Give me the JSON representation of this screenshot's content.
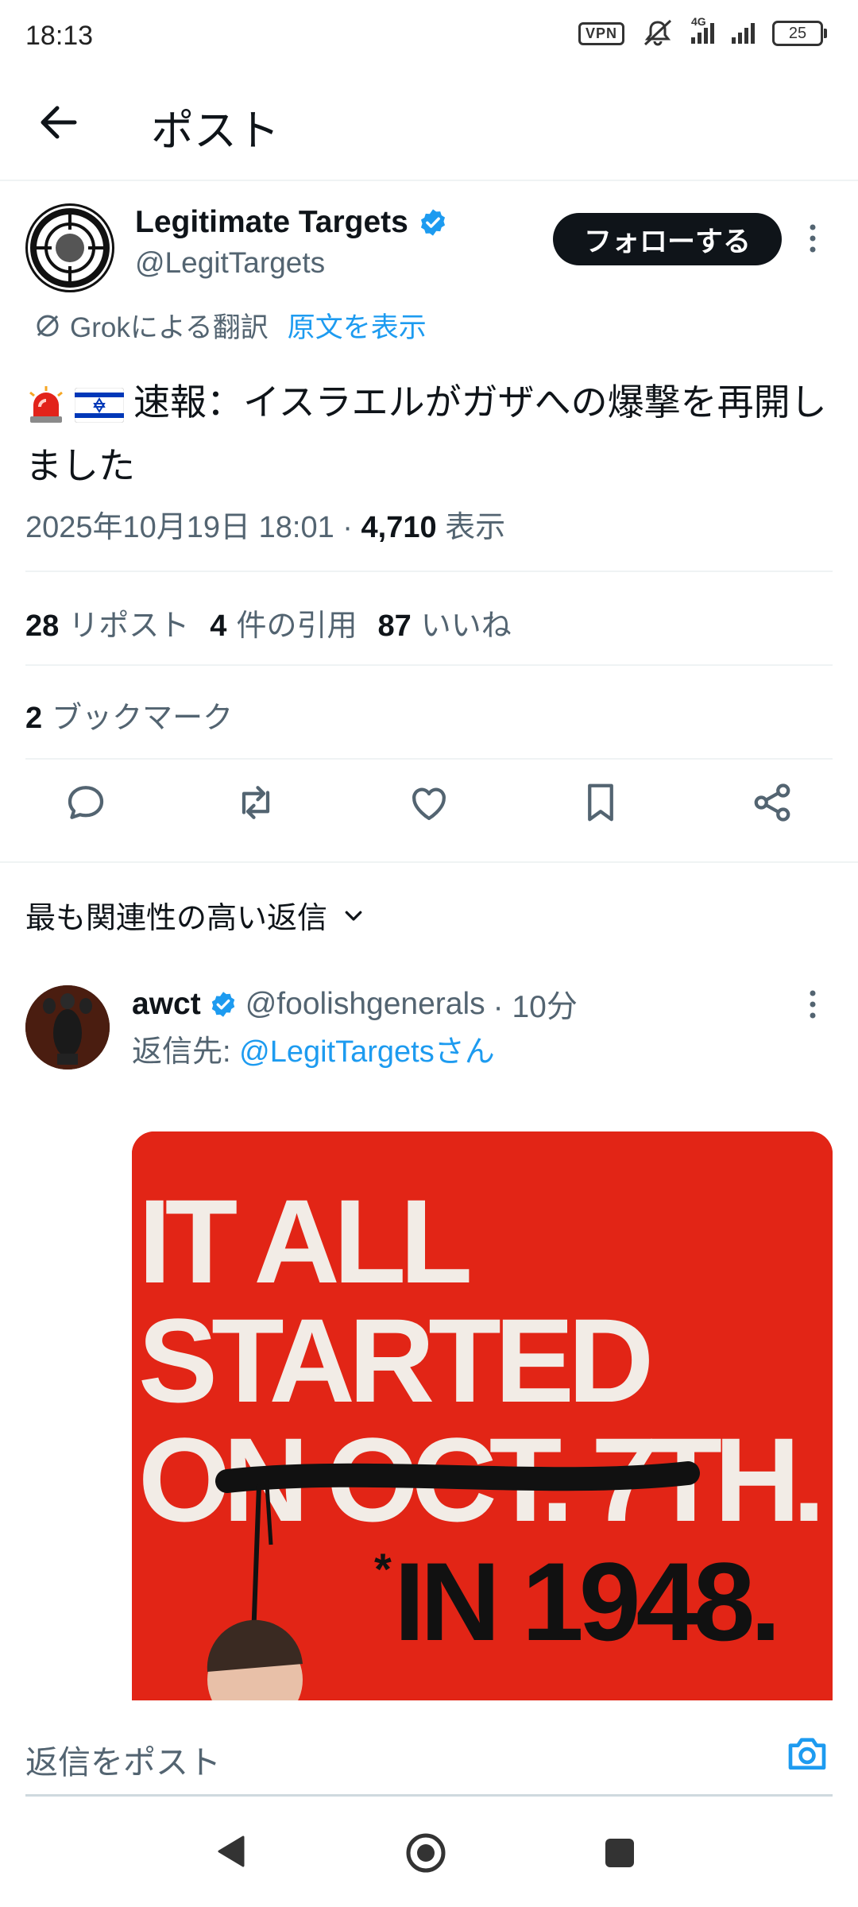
{
  "status_bar": {
    "time": "18:13",
    "vpn": "VPN",
    "network": "4G",
    "battery": "25"
  },
  "header": {
    "title": "ポスト"
  },
  "post": {
    "author_name": "Legitimate Targets",
    "author_handle": "@LegitTargets",
    "follow_label": "フォローする",
    "translate_label": "Grokによる翻訳",
    "show_original_label": "原文を表示",
    "text": "速報：イスラエルがガザへの爆撃を再開しました",
    "timestamp": "2025年10月19日 18:01 · ",
    "views_count": "4,710",
    "views_label": " 表示",
    "reposts_count": "28",
    "reposts_label": "リポスト",
    "quotes_count": "4",
    "quotes_label": "件の引用",
    "likes_count": "87",
    "likes_label": "いいね",
    "bookmarks_count": "2",
    "bookmarks_label": "ブックマーク"
  },
  "replies_section": {
    "sort_label": "最も関連性の高い返信"
  },
  "reply": {
    "name": "awct",
    "handle": "@foolishgenerals",
    "time": "· 10分",
    "reply_to_prefix": "返信先: ",
    "reply_to_handle": "@LegitTargetsさん",
    "image_lines": [
      "IT ALL",
      "STARTED",
      "ON OCT. 7TH.",
      "IN 1948."
    ],
    "image_asterisk": "*"
  },
  "compose": {
    "placeholder": "返信をポスト"
  },
  "colors": {
    "accent": "#1d9bf0",
    "text": "#0f1419",
    "muted": "#536471",
    "image_red": "#e22516"
  },
  "icons": [
    "back-arrow-icon",
    "verified-icon",
    "more-icon",
    "grok-icon",
    "reply-icon",
    "repost-icon",
    "like-icon",
    "bookmark-icon",
    "share-icon",
    "chevron-down-icon",
    "camera-icon",
    "nav-back-icon",
    "nav-home-icon",
    "nav-recents-icon"
  ]
}
